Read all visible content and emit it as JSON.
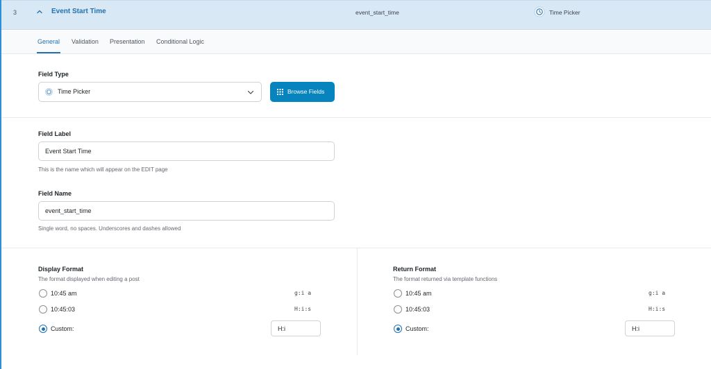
{
  "header": {
    "order": "3",
    "title": "Event Start Time",
    "field_name": "event_start_time",
    "field_type": "Time Picker"
  },
  "tabs": [
    {
      "label": "General",
      "active": true
    },
    {
      "label": "Validation",
      "active": false
    },
    {
      "label": "Presentation",
      "active": false
    },
    {
      "label": "Conditional Logic",
      "active": false
    }
  ],
  "field_type": {
    "label": "Field Type",
    "value": "Time Picker",
    "browse_label": "Browse Fields"
  },
  "field_label": {
    "label": "Field Label",
    "value": "Event Start Time",
    "description": "This is the name which will appear on the EDIT page"
  },
  "field_name": {
    "label": "Field Name",
    "value": "event_start_time",
    "description": "Single word, no spaces. Underscores and dashes allowed"
  },
  "display_format": {
    "label": "Display Format",
    "description": "The format displayed when editing a post",
    "options": [
      {
        "label": "10:45 am",
        "code": "g:i a",
        "checked": false
      },
      {
        "label": "10:45:03",
        "code": "H:i:s",
        "checked": false
      },
      {
        "label": "Custom:",
        "code": "",
        "checked": true
      }
    ],
    "custom_value": "H:i"
  },
  "return_format": {
    "label": "Return Format",
    "description": "The format returned via template functions",
    "options": [
      {
        "label": "10:45 am",
        "code": "g:i a",
        "checked": false
      },
      {
        "label": "10:45:03",
        "code": "H:i:s",
        "checked": false
      },
      {
        "label": "Custom:",
        "code": "",
        "checked": true
      }
    ],
    "custom_value": "H:i"
  },
  "colors": {
    "accent": "#2271b1",
    "button": "#0783be",
    "header_bg": "#d8e8f5"
  }
}
